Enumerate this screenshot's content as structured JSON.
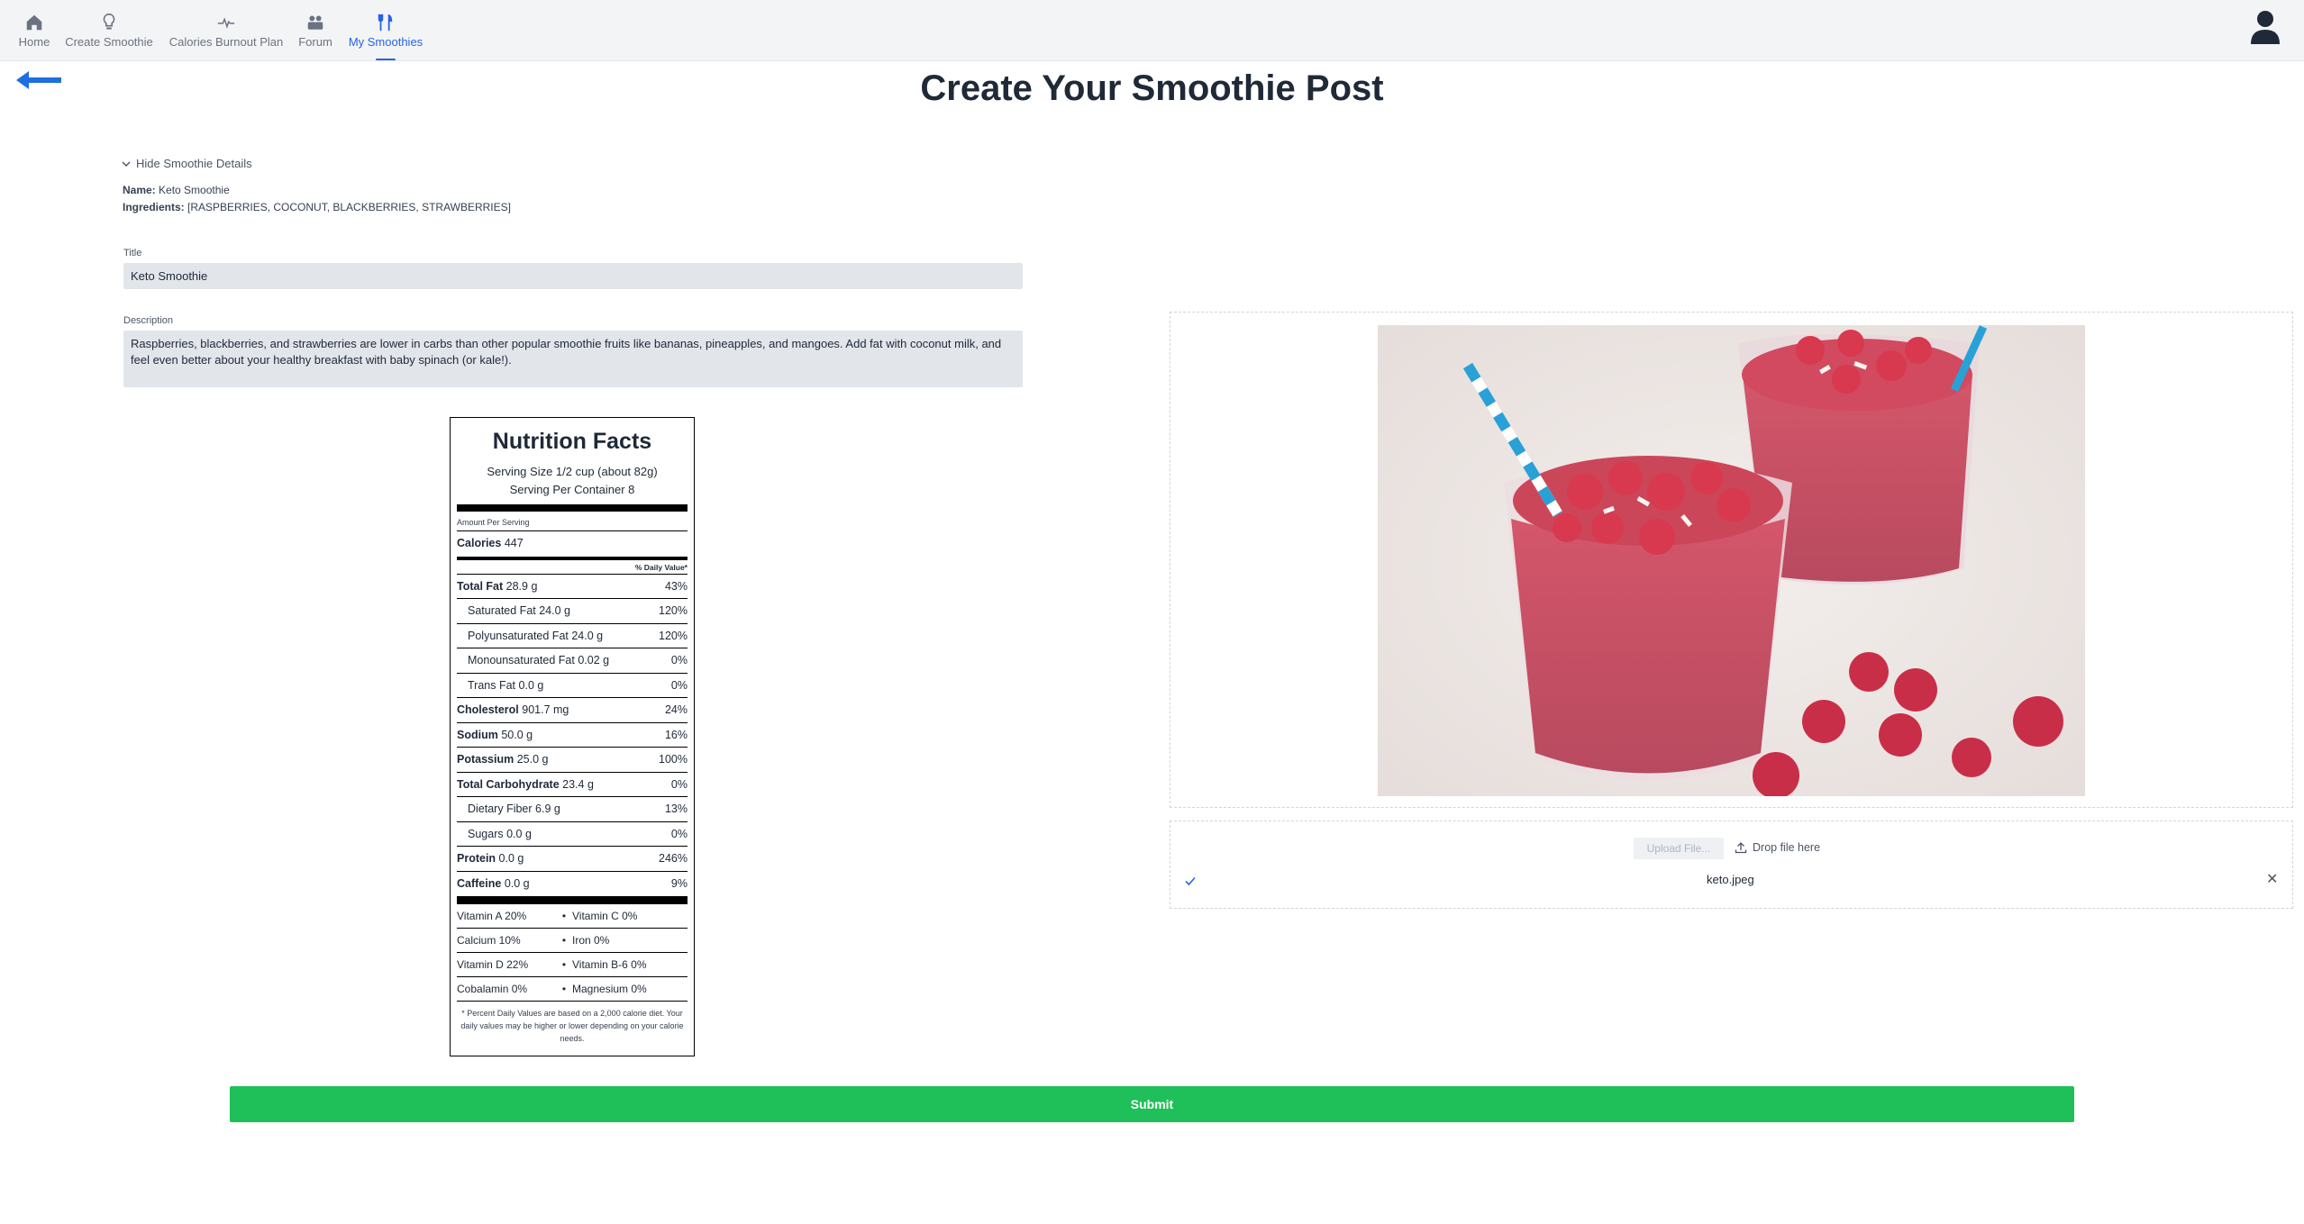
{
  "nav": {
    "items": [
      {
        "label": "Home",
        "icon": "home-icon"
      },
      {
        "label": "Create Smoothie",
        "icon": "lightbulb-icon"
      },
      {
        "label": "Calories Burnout Plan",
        "icon": "heartbeat-icon"
      },
      {
        "label": "Forum",
        "icon": "users-icon"
      },
      {
        "label": "My Smoothies",
        "icon": "utensils-icon"
      }
    ],
    "active": "My Smoothies",
    "accent": "#2563eb"
  },
  "page": {
    "title": "Create Your Smoothie Post"
  },
  "details": {
    "toggle_label": "Hide Smoothie Details",
    "name_label": "Name:",
    "name_value": "Keto Smoothie",
    "ingredients_label": "Ingredients:",
    "ingredients_value": "[RASPBERRIES, COCONUT, BLACKBERRIES, STRAWBERRIES]"
  },
  "form": {
    "title_label": "Title",
    "title_value": "Keto Smoothie",
    "description_label": "Description",
    "description_value": "Raspberries, blackberries, and strawberries are lower in carbs than other popular smoothie fruits like bananas, pineapples, and mangoes. Add fat with coconut milk, and feel even better about your healthy breakfast with baby spinach (or kale!).",
    "submit_label": "Submit"
  },
  "nutrition": {
    "title": "Nutrition Facts",
    "serving_size": "Serving Size 1/2 cup (about 82g)",
    "servings_per_container": "Serving Per Container 8",
    "amount_per_serving": "Amount Per Serving",
    "calories_label": "Calories",
    "calories_value": "447",
    "daily_value_header": "% Daily Value*",
    "rows": [
      {
        "label": "Total Fat",
        "amount": "28.9 g",
        "dv": "43%",
        "bold": true
      },
      {
        "label": "Saturated Fat",
        "amount": "24.0 g",
        "dv": "120%",
        "bold": false
      },
      {
        "label": "Polyunsaturated Fat",
        "amount": "24.0 g",
        "dv": "120%",
        "bold": false
      },
      {
        "label": "Monounsaturated Fat",
        "amount": "0.02 g",
        "dv": "0%",
        "bold": false
      },
      {
        "label": "Trans Fat",
        "amount": "0.0 g",
        "dv": "0%",
        "bold": false
      },
      {
        "label": "Cholesterol",
        "amount": "901.7 mg",
        "dv": "24%",
        "bold": true
      },
      {
        "label": "Sodium",
        "amount": "50.0 g",
        "dv": "16%",
        "bold": true
      },
      {
        "label": "Potassium",
        "amount": "25.0 g",
        "dv": "100%",
        "bold": true
      },
      {
        "label": "Total Carbohydrate",
        "amount": "23.4 g",
        "dv": "0%",
        "bold": true
      },
      {
        "label": "Dietary Fiber",
        "amount": "6.9 g",
        "dv": "13%",
        "bold": false
      },
      {
        "label": "Sugars",
        "amount": "0.0 g",
        "dv": "0%",
        "bold": false
      },
      {
        "label": "Protein",
        "amount": "0.0 g",
        "dv": "246%",
        "bold": true
      },
      {
        "label": "Caffeine",
        "amount": "0.0 g",
        "dv": "9%",
        "bold": true
      }
    ],
    "vitamins": [
      [
        "Vitamin A 20%",
        "Vitamin C 0%"
      ],
      [
        "Calcium 10%",
        "Iron 0%"
      ],
      [
        "Vitamin D 22%",
        "Vitamin B-6 0%"
      ],
      [
        "Cobalamin 0%",
        "Magnesium 0%"
      ]
    ],
    "footnote": "* Percent Daily Values are based on a 2,000 calorie diet. Your daily values may be higher or lower depending on your calorie needs."
  },
  "upload": {
    "button_label": "Upload File...",
    "drop_label": "Drop file here",
    "file_name": "keto.jpeg",
    "close_glyph": "✕"
  }
}
